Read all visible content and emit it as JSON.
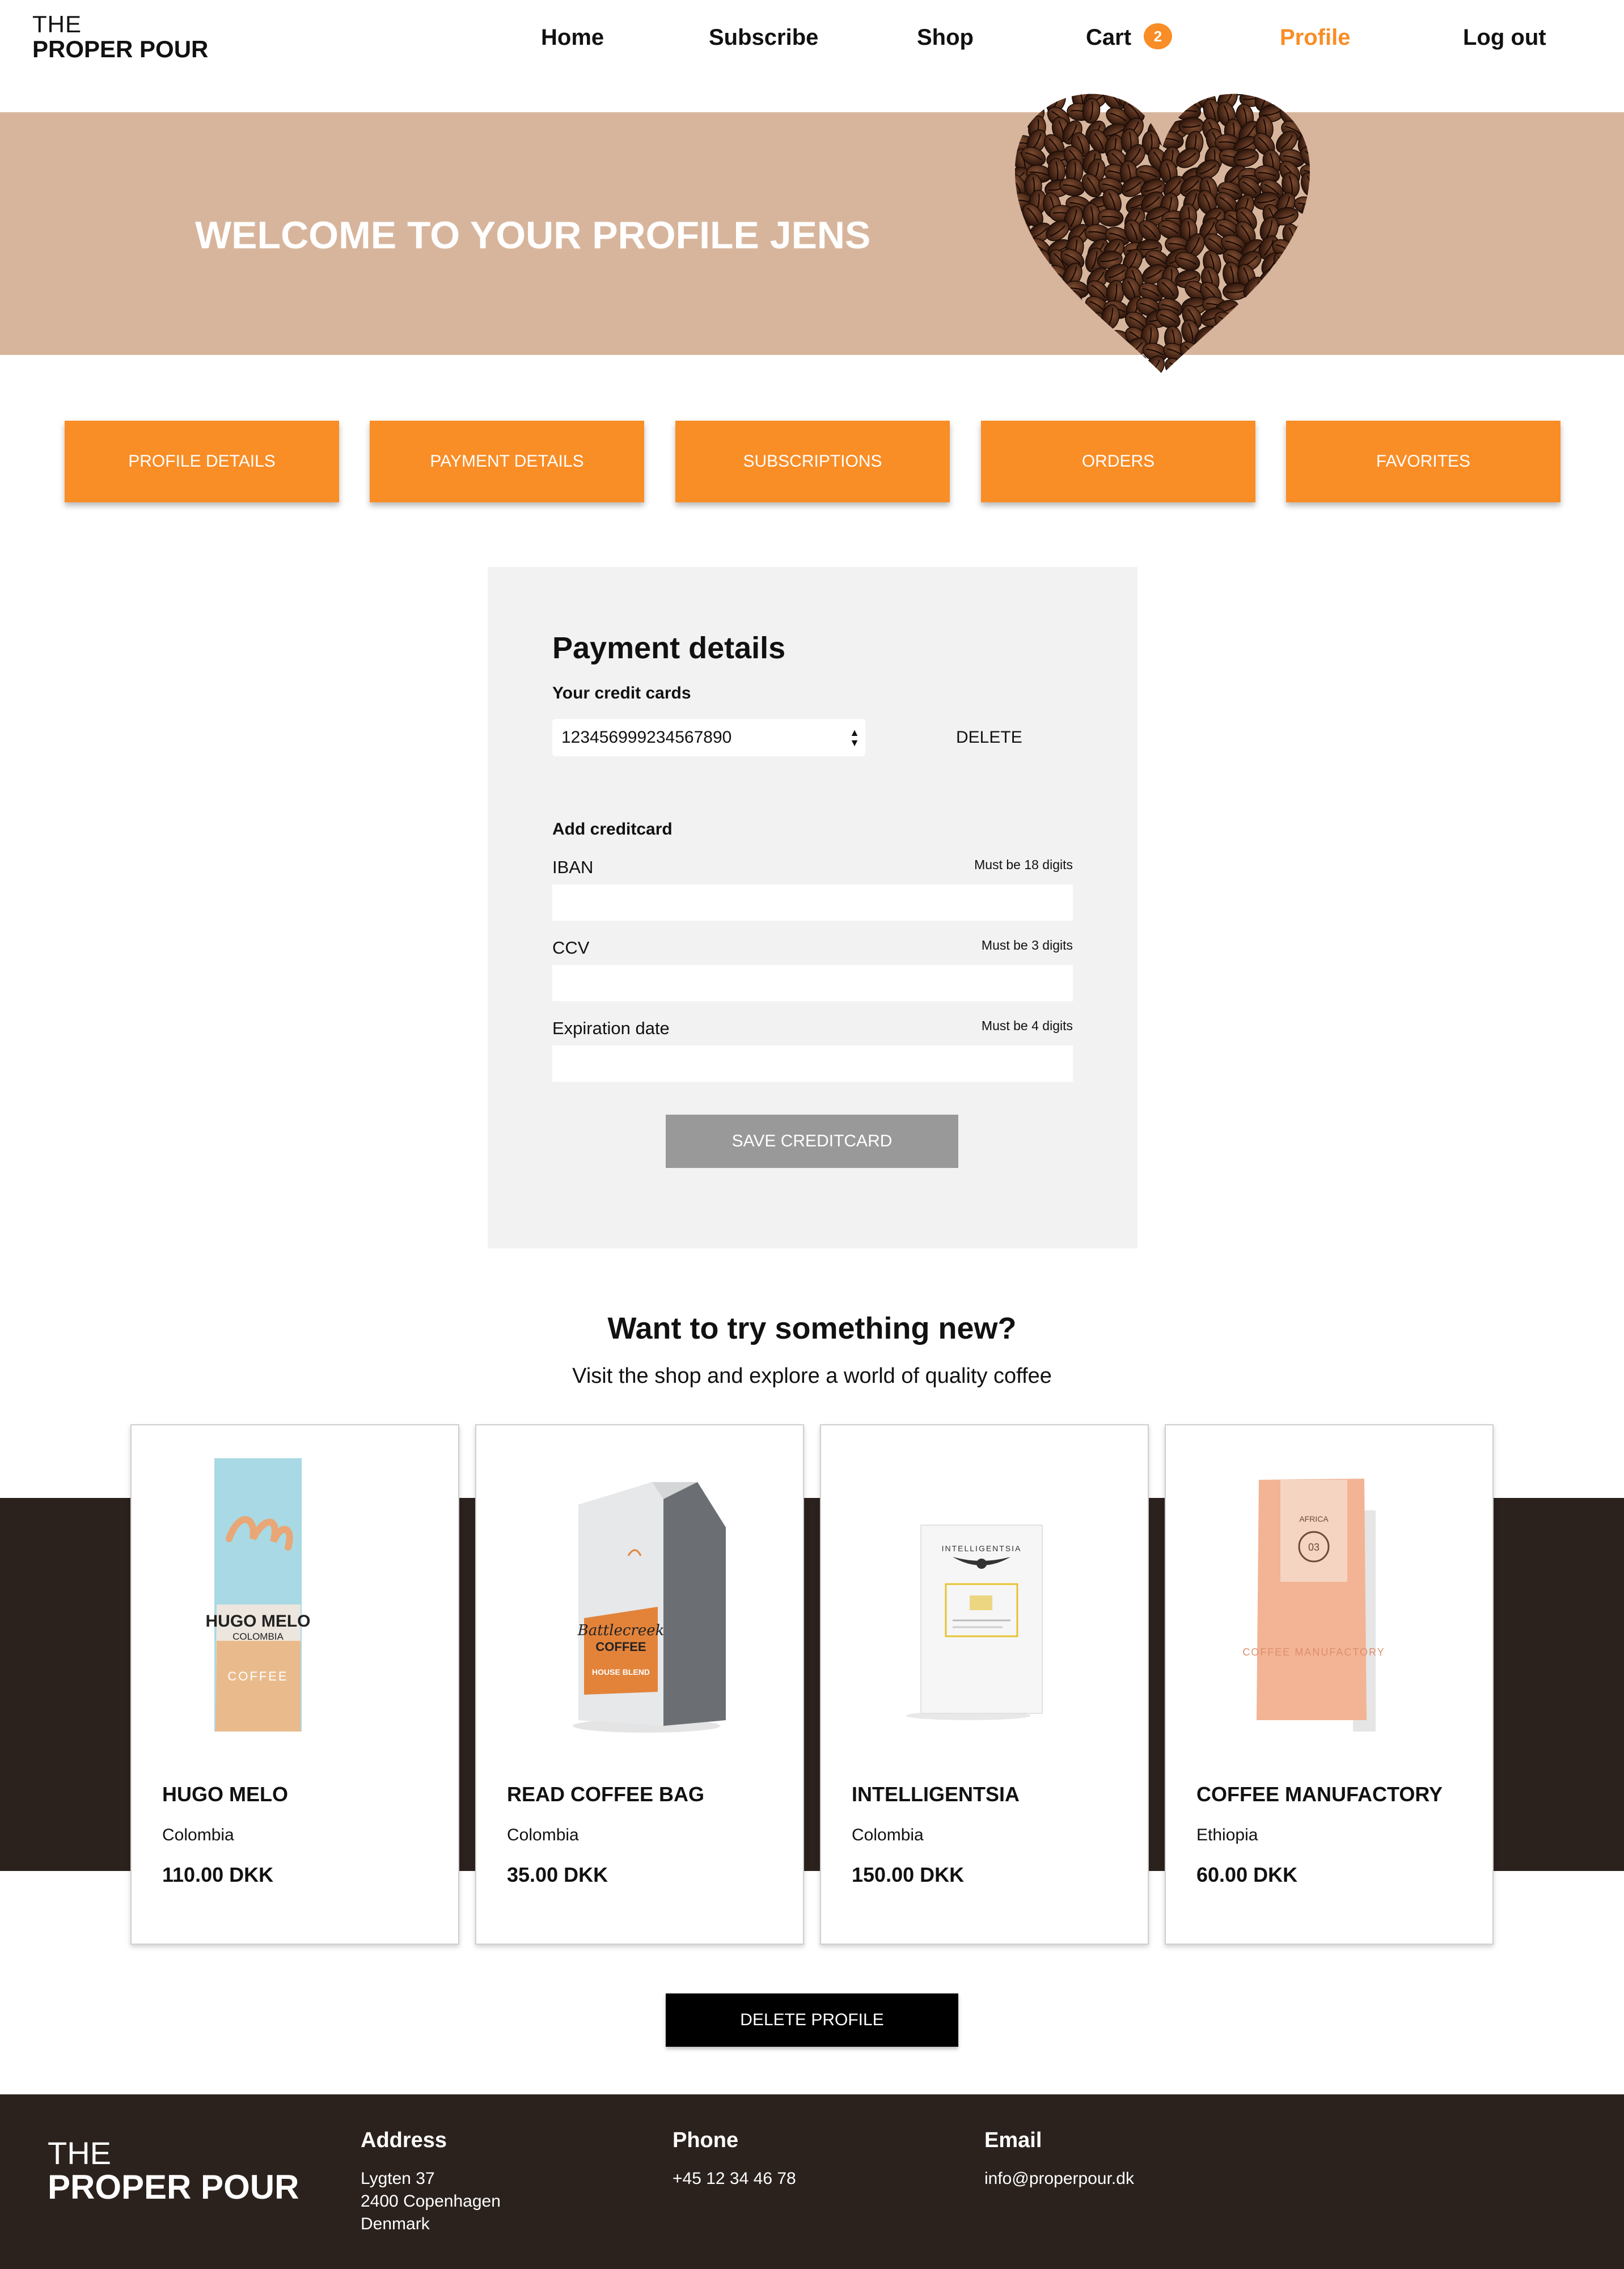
{
  "brand": {
    "line1": "THE",
    "line2": "PROPER POUR"
  },
  "nav": {
    "home": "Home",
    "subscribe": "Subscribe",
    "shop": "Shop",
    "cart": "Cart",
    "cart_count": "2",
    "profile": "Profile",
    "logout": "Log out"
  },
  "hero": {
    "title": "WELCOME TO YOUR PROFILE JENS"
  },
  "tabs": [
    "PROFILE DETAILS",
    "PAYMENT DETAILS",
    "SUBSCRIPTIONS",
    "ORDERS",
    "FAVORITES"
  ],
  "payment": {
    "title": "Payment details",
    "cards_label": "Your credit cards",
    "selected_card": "123456999234567890",
    "delete_label": "DELETE",
    "add_title": "Add creditcard",
    "fields": [
      {
        "label": "IBAN",
        "hint": "Must be 18 digits",
        "value": ""
      },
      {
        "label": "CCV",
        "hint": "Must be 3 digits",
        "value": ""
      },
      {
        "label": "Expiration date",
        "hint": "Must be 4 digits",
        "value": ""
      }
    ],
    "save_label": "SAVE CREDITCARD"
  },
  "suggestions": {
    "title": "Want to try something new?",
    "subtitle": "Visit the shop and explore a world of quality coffee",
    "products": [
      {
        "name": "HUGO MELO",
        "origin": "Colombia",
        "price": "110.00 DKK",
        "bag_text": "HUGO MELO",
        "bag_sub": "COLOMBIA",
        "bag_word": "COFFEE"
      },
      {
        "name": "READ COFFEE BAG",
        "origin": "Colombia",
        "price": "35.00 DKK",
        "bag_text": "Battlecreek",
        "bag_sub": "COFFEE",
        "bag_word": "HOUSE BLEND"
      },
      {
        "name": "INTELLIGENTSIA",
        "origin": "Colombia",
        "price": "150.00 DKK",
        "bag_text": "INTELLIGENTSIA"
      },
      {
        "name": "COFFEE MANUFACTORY",
        "origin": "Ethiopia",
        "price": "60.00 DKK",
        "bag_text": "AFRICA",
        "bag_sub": "03",
        "bag_word": "COFFEE MANUFACTORY"
      }
    ]
  },
  "delete_profile_label": "DELETE PROFILE",
  "footer": {
    "address_title": "Address",
    "address_lines": [
      "Lygten 37",
      "2400 Copenhagen",
      "Denmark"
    ],
    "phone_title": "Phone",
    "phone": "+45 12 34 46 78",
    "email_title": "Email",
    "email": "info@properpour.dk"
  },
  "colors": {
    "accent": "#F98D26",
    "hero": "#D7B59C",
    "dark": "#2B221E",
    "panel": "#F2F2F2"
  }
}
